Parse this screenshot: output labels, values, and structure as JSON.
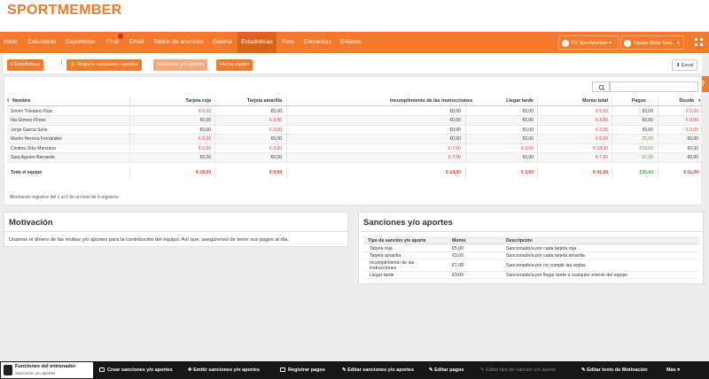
{
  "app": {
    "logo": "SPORTMEMBER"
  },
  "nav": {
    "items": [
      "Inicio",
      "Calendario",
      "Deportistas",
      "Chat",
      "Email",
      "Tablón de anuncios",
      "Galería",
      "Estadísticas",
      "Foro",
      "Encuestas",
      "Enlaces"
    ],
    "active": "Estadísticas",
    "chat_badge": "",
    "club": "FC SportMember",
    "team": "Equipo Mixto Spor..."
  },
  "toolbar": {
    "stats": "Estadísticas",
    "register": "Registro sanciones / aportes",
    "sanctions": "Sanciones y/o aportes",
    "sheet": "Hucha equipo",
    "excel": "Excel"
  },
  "help": "?",
  "table": {
    "headers": [
      "Nombre",
      "Tarjeta roja",
      "Tarjeta amarilla",
      "Incumplimiento de las instrucciones",
      "Llegar tarde",
      "Monto total",
      "Pagos",
      "Deuda"
    ],
    "rows": [
      [
        "Simón Toledano Ruiz",
        "€-5,00",
        "€0,00",
        "€0,00",
        "€0,00",
        "€-5,00",
        "€0,00",
        "€-5,00"
      ],
      [
        "Ida Gómez Flores",
        "€0,00",
        "€-3,00",
        "€0,00",
        "€0,00",
        "€-3,00",
        "€0,00",
        "€-3,00"
      ],
      [
        "Jorge García Solís",
        "€0,00",
        "€-3,00",
        "€0,00",
        "€0,00",
        "€-3,00",
        "€0,00",
        "€-3,00"
      ],
      [
        "Martín Herrera Fernández",
        "€-5,00",
        "€0,00",
        "€0,00",
        "€0,00",
        "€-5,00",
        "€5,00",
        "€0,00"
      ],
      [
        "Cristina Ortiz Manzano",
        "€-5,00",
        "€-3,00",
        "€-7,00",
        "€-3,00",
        "€-18,00",
        "€18,00",
        "€0,00"
      ],
      [
        "Sara Aguirre Bernardo",
        "€0,00",
        "€0,00",
        "€-7,00",
        "€0,00",
        "€-7,00",
        "€7,00",
        "€0,00"
      ]
    ],
    "total": [
      "Todo el equipo",
      "€-15,00",
      "€-9,00",
      "€-14,00",
      "€-3,00",
      "€-41,00",
      "€30,00",
      "€-11,00"
    ],
    "footer": "Mostrando registros del 1 al 6 de un total de 6 registros"
  },
  "motivation": {
    "title": "Motivación",
    "text": "Usamos el dinero de las multas y/o aportes para la contribución del equipo. Así que, asegúrense de tener sus pagos al día."
  },
  "sanctions": {
    "title": "Sanciones y/o aportes",
    "headers": [
      "Tipo de sanción y/o aporte",
      "Monto",
      "Descripción"
    ],
    "rows": [
      [
        "Tarjeta roja",
        "€5,00",
        "Sancionado/a por cada tarjeta roja"
      ],
      [
        "Tarjeta amarilla",
        "€3,00",
        "Sancionado/a por cada tarjeta amarilla"
      ],
      [
        "Incumplimiento de las instrucciones",
        "€7,00",
        "Sancionado/a por no cumplir las reglas"
      ],
      [
        "Llegar tarde",
        "€3,00",
        "Sancionado/a por llegar tarde a cualquier evento del equipo"
      ]
    ]
  },
  "bottom": {
    "coach_title": "Funciones del entrenador",
    "coach_sub": "Sanciones y/o aportes",
    "actions": [
      "Crear sanciones y/o aportes",
      "Emitir sanciones y/o aportes",
      "Registrar pagos",
      "Editar sanciones y/o aportes",
      "Editar pagos",
      "Editar tipo de sanción y/o aporte",
      "Editar texto de Motivación",
      "Más"
    ]
  },
  "colors": {
    "accent": "#f37a2a",
    "negative": "#e53935",
    "positive": "#43a047"
  }
}
